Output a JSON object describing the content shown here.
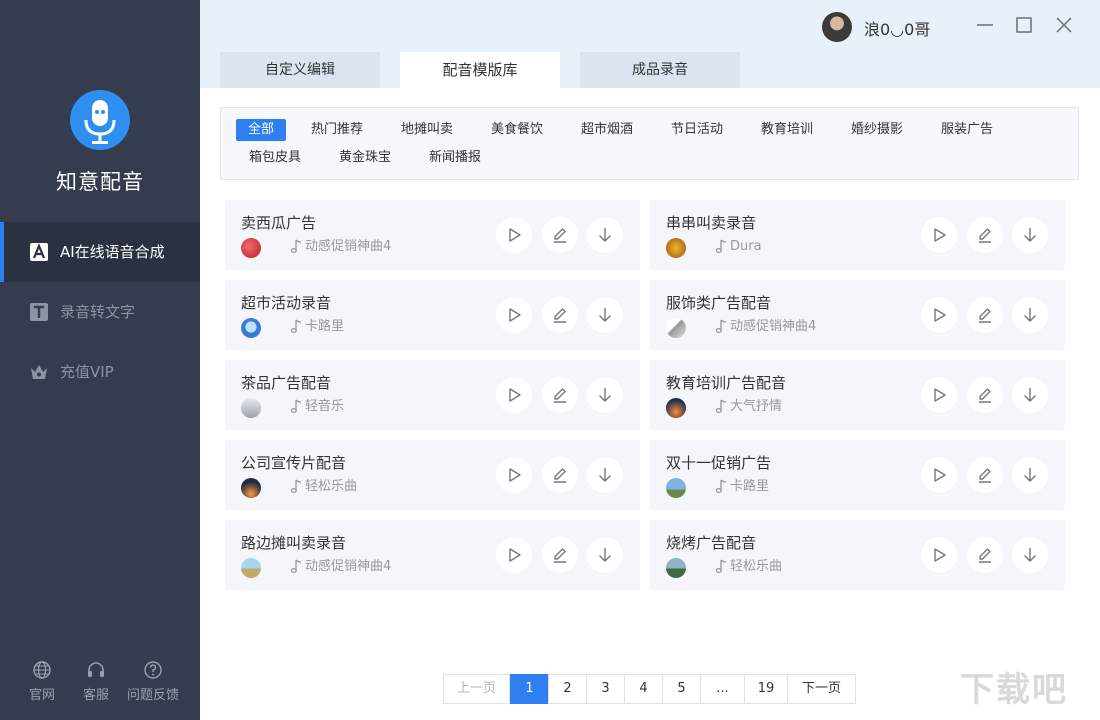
{
  "app": {
    "name": "知意配音"
  },
  "sidebar": {
    "items": [
      {
        "label": "AI在线语音合成",
        "icon": "ai-letter-icon",
        "active": true
      },
      {
        "label": "录音转文字",
        "icon": "text-t-icon",
        "active": false
      },
      {
        "label": "充值VIP",
        "icon": "crown-icon",
        "active": false
      }
    ],
    "footer": [
      {
        "label": "官网",
        "icon": "globe-icon"
      },
      {
        "label": "客服",
        "icon": "headset-icon"
      },
      {
        "label": "问题反馈",
        "icon": "question-icon"
      }
    ]
  },
  "header": {
    "username": "浪0◡0哥"
  },
  "tabs": [
    {
      "label": "自定义编辑",
      "active": false
    },
    {
      "label": "配音模版库",
      "active": true
    },
    {
      "label": "成品录音",
      "active": false
    }
  ],
  "categories": [
    {
      "label": "全部",
      "active": true
    },
    {
      "label": "热门推荐"
    },
    {
      "label": "地摊叫卖"
    },
    {
      "label": "美食餐饮"
    },
    {
      "label": "超市烟酒"
    },
    {
      "label": "节日活动"
    },
    {
      "label": "教育培训"
    },
    {
      "label": "婚纱摄影"
    },
    {
      "label": "服装广告"
    },
    {
      "label": "箱包皮具"
    },
    {
      "label": "黄金珠宝"
    },
    {
      "label": "新闻播报"
    }
  ],
  "templates": [
    {
      "title": "卖西瓜广告",
      "music": "动感促销神曲4"
    },
    {
      "title": "串串叫卖录音",
      "music": "Dura"
    },
    {
      "title": "超市活动录音",
      "music": "卡路里"
    },
    {
      "title": "服饰类广告配音",
      "music": "动感促销神曲4"
    },
    {
      "title": "茶品广告配音",
      "music": "轻音乐"
    },
    {
      "title": "教育培训广告配音",
      "music": "大气抒情"
    },
    {
      "title": "公司宣传片配音",
      "music": "轻松乐曲"
    },
    {
      "title": "双十一促销广告",
      "music": "卡路里"
    },
    {
      "title": "路边摊叫卖录音",
      "music": "动感促销神曲4"
    },
    {
      "title": "烧烤广告配音",
      "music": "轻松乐曲"
    }
  ],
  "pagination": {
    "prev": "上一页",
    "pages": [
      "1",
      "2",
      "3",
      "4",
      "5",
      "...",
      "19"
    ],
    "current": "1",
    "next": "下一页"
  },
  "watermark": "下载吧"
}
